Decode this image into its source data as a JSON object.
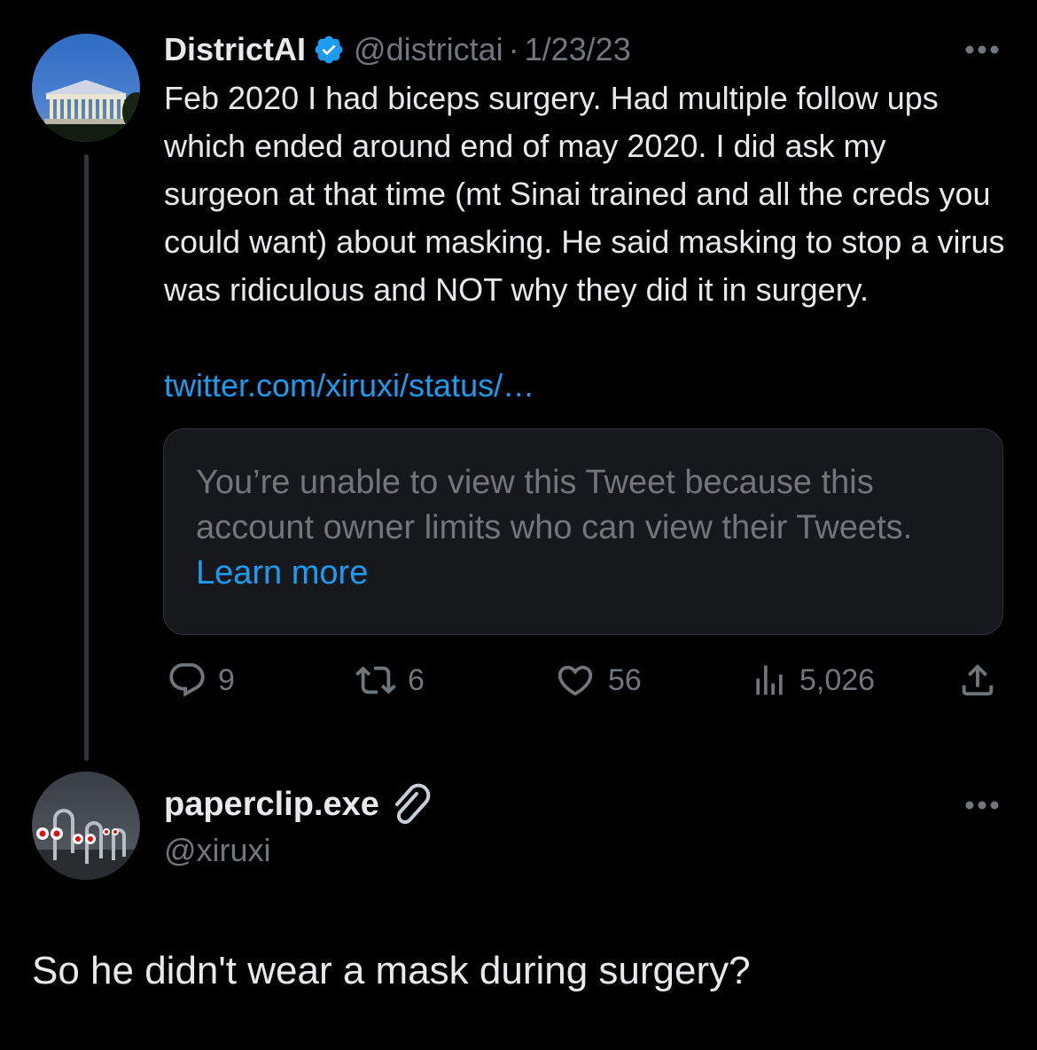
{
  "tweet": {
    "author": {
      "display_name": "DistrictAI",
      "handle": "@districtai",
      "verified": true,
      "avatar_icon": "memorial-avatar"
    },
    "separator": "·",
    "date": "1/23/23",
    "text": "Feb 2020 I had biceps surgery.  Had multiple follow ups which ended around end of may 2020. I did ask my surgeon at that time (mt Sinai trained and all the creds you could want) about masking.  He said masking to stop a virus was ridiculous and NOT why they did it in surgery.",
    "link": "twitter.com/xiruxi/status/…",
    "quoted_tweet": {
      "message": "You’re unable to view this Tweet because this account owner limits who can view their Tweets.",
      "link_text": "Learn more"
    },
    "actions": {
      "replies": "9",
      "retweets": "6",
      "likes": "56",
      "views": "5,026"
    },
    "menu_icon": "more-icon"
  },
  "reply": {
    "author": {
      "display_name": "paperclip.exe",
      "name_emoji": "paperclip-icon",
      "handle": "@xiruxi",
      "avatar_icon": "paperclip-characters-avatar"
    },
    "text": "So he didn't wear a mask during surgery?",
    "menu_icon": "more-icon"
  },
  "colors": {
    "background": "#000000",
    "text_primary": "#E7E9EA",
    "text_secondary": "#71767B",
    "accent": "#1D9BF0",
    "quote_background": "#16181C",
    "border": "#2F3336"
  }
}
